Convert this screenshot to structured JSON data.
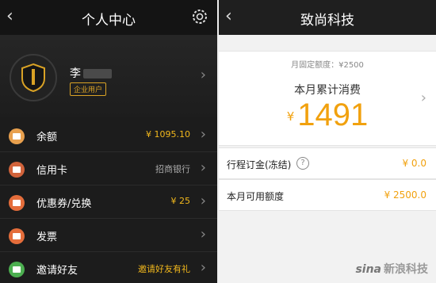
{
  "left": {
    "nav_title": "个人中心",
    "back_icon": "chevron-left-icon",
    "settings_icon": "gear-icon",
    "profile": {
      "name": "李",
      "badge": "企业用户"
    },
    "menu": [
      {
        "label": "余额",
        "value": "¥ 1095.10",
        "value_color": "#f2b81c",
        "icon_color": "#e8a04e",
        "icon": "wallet-icon"
      },
      {
        "label": "信用卡",
        "value": "招商银行",
        "value_color": "#aaaaaa",
        "icon_color": "#d1633b",
        "icon": "credit-card-icon"
      },
      {
        "label": "优惠券/兑换",
        "value": "¥ 25",
        "value_color": "#f2b81c",
        "icon_color": "#e46d3b",
        "icon": "coupon-icon"
      },
      {
        "label": "发票",
        "value": "",
        "value_color": "#aaaaaa",
        "icon_color": "#e46d3b",
        "icon": "invoice-icon"
      },
      {
        "label": "邀请好友",
        "value": "邀请好友有礼",
        "value_color": "#f2b81c",
        "icon_color": "#4caf50",
        "icon": "invite-icon"
      }
    ]
  },
  "right": {
    "nav_title": "致尚科技",
    "back_icon": "chevron-left-icon",
    "fixed_limit": "月固定额度：¥2500",
    "monthly_label": "本月累计消费",
    "currency": "¥",
    "monthly_amount": "1491",
    "deposit_label": "行程订金(冻结)",
    "deposit_value": "¥ 0.0",
    "available_label": "本月可用额度",
    "available_value": "¥ 2500.0"
  },
  "watermark": {
    "logo": "sina",
    "text": "新浪科技"
  },
  "colors": {
    "accent": "#f1a10e",
    "gold": "#d9a225"
  }
}
